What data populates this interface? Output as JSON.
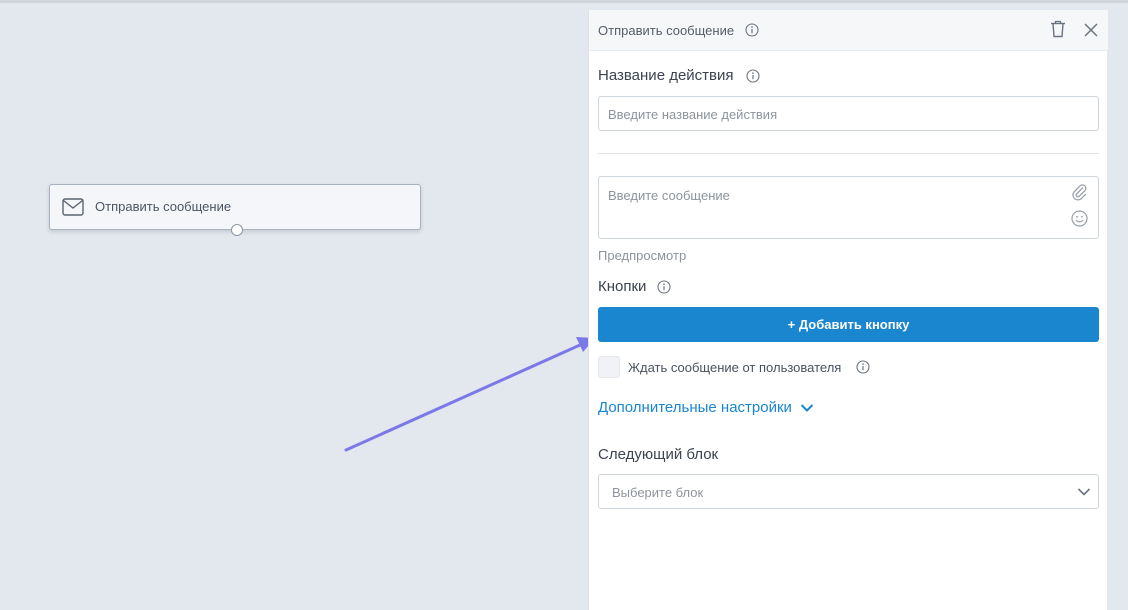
{
  "canvas": {
    "node": {
      "icon": "envelope-icon",
      "label": "Отправить сообщение"
    }
  },
  "panel": {
    "header": {
      "title": "Отправить сообщение",
      "info_icon": "info-icon",
      "delete_icon": "trash-icon",
      "close_icon": "close-icon"
    },
    "action_name": {
      "label": "Название действия",
      "placeholder": "Введите название действия"
    },
    "message": {
      "placeholder": "Введите сообщение",
      "attach_icon": "paperclip-icon",
      "emoji_icon": "emoji-icon"
    },
    "preview_label": "Предпросмотр",
    "buttons": {
      "label": "Кнопки",
      "add_button_label": "+ Добавить кнопку"
    },
    "wait_for_user": {
      "label": "Ждать сообщение от пользователя",
      "checked": false
    },
    "advanced_settings_label": "Дополнительные настройки",
    "next_block": {
      "label": "Следующий блок",
      "placeholder": "Выберите блок"
    }
  },
  "colors": {
    "accent": "#1a86d0",
    "canvas_bg": "#e3e7ee",
    "arrow": "#7b78e8"
  }
}
